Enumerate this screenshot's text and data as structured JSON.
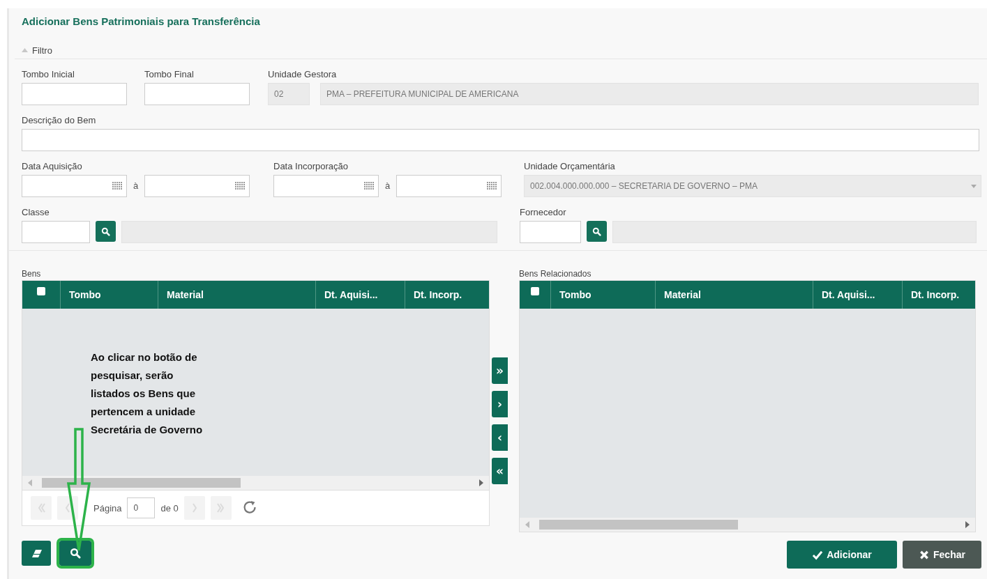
{
  "title": "Adicionar Bens Patrimoniais para Transferência",
  "filter": {
    "legend": "Filtro",
    "expanded": true,
    "tombo_inicial": {
      "label": "Tombo Inicial"
    },
    "tombo_final": {
      "label": "Tombo Final"
    },
    "unidade_gestora": {
      "label": "Unidade Gestora",
      "code": "02",
      "name": "PMA – PREFEITURA MUNICIPAL DE AMERICANA",
      "disabled": true
    },
    "descricao": {
      "label": "Descrição do Bem"
    },
    "data_aquisicao": {
      "label": "Data Aquisição",
      "separator": "à"
    },
    "data_incorporacao": {
      "label": "Data Incorporação",
      "separator": "à"
    },
    "unidade_orcamentaria": {
      "label": "Unidade Orçamentária",
      "value": "002.004.000.000.000 – SECRETARIA DE GOVERNO – PMA",
      "disabled": true
    },
    "classe": {
      "label": "Classe"
    },
    "fornecedor": {
      "label": "Fornecedor"
    }
  },
  "bens": {
    "title": "Bens",
    "select_all": false,
    "columns": [
      "Tombo",
      "Material",
      "Dt. Aquisi...",
      "Dt. Incorp."
    ],
    "pager": {
      "page_label": "Página",
      "page": "0",
      "of": "de 0"
    }
  },
  "transfer_buttons": [
    "»",
    "›",
    "‹",
    "«"
  ],
  "bens_relacionados": {
    "title": "Bens Relacionados",
    "select_all": false,
    "columns": [
      "Tombo",
      "Material",
      "Dt. Aquisi...",
      "Dt. Incorp."
    ]
  },
  "annotation": {
    "lines": [
      "Ao clicar no botão de",
      "pesquisar, serão",
      "listados os Bens que",
      "pertencem a unidade",
      "Secretária de Governo"
    ]
  },
  "tools": [
    {
      "kind": "clear",
      "highlighted": false
    },
    {
      "kind": "search",
      "highlighted": true
    }
  ],
  "footer_buttons": [
    {
      "label": "Adicionar",
      "kind": "primary"
    },
    {
      "label": "Fechar",
      "kind": "secondary"
    }
  ]
}
